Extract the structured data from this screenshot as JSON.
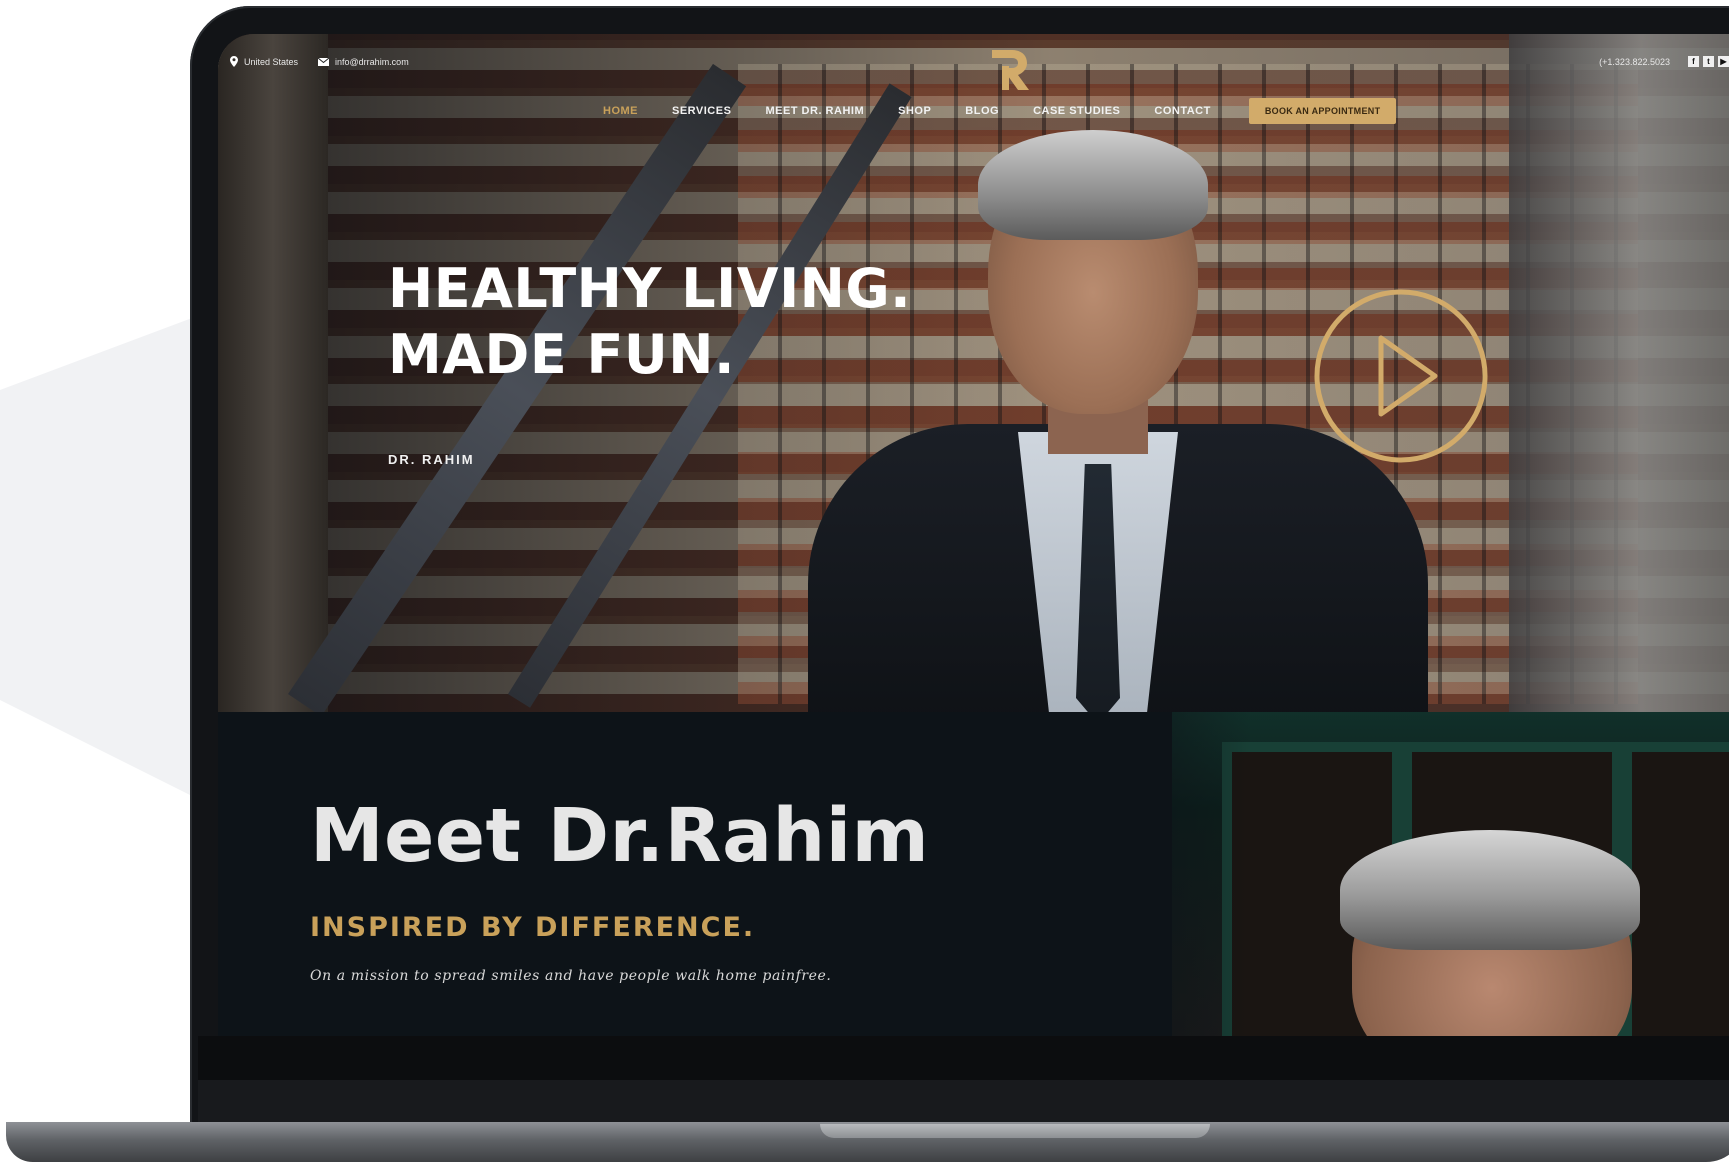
{
  "topbar": {
    "location": "United States",
    "email": "info@drrahim.com",
    "phone": "(+1.323.822.5023",
    "social_icons": [
      "facebook-icon",
      "twitter-icon",
      "youtube-icon"
    ]
  },
  "logo": {
    "icon": "r-monogram-logo"
  },
  "nav": {
    "items": [
      "HOME",
      "SERVICES",
      "MEET DR. RAHIM",
      "SHOP",
      "BLOG",
      "CASE STUDIES",
      "CONTACT"
    ],
    "active_index": 0,
    "cta_label": "BOOK AN APPOINTMENT"
  },
  "hero": {
    "title_line1": "HEALTHY LIVING.",
    "title_line2": "MADE FUN.",
    "subtitle": "DR. RAHIM",
    "play_icon": "play-icon"
  },
  "meet": {
    "title": "Meet Dr.Rahim",
    "subtitle": "INSPIRED BY DIFFERENCE.",
    "text": "On a mission to spread smiles and have people walk home painfree."
  },
  "colors": {
    "accent": "#c9a15a",
    "cta_bg": "#d2ab6a",
    "dark_bg": "#0d1318"
  }
}
